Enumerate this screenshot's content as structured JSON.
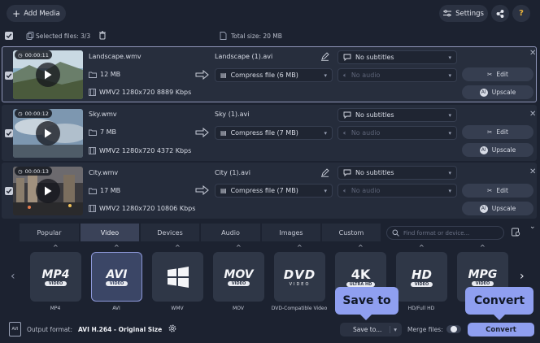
{
  "toolbar": {
    "add_media_label": "Add Media",
    "settings_label": "Settings",
    "help_label": "?"
  },
  "summary": {
    "selected_label": "Selected files: 3/3",
    "total_label": "Total size: 20 MB"
  },
  "files": [
    {
      "duration": "00:00:11",
      "name": "Landscape.wmv",
      "size": "12 MB",
      "codec": "WMV2 1280x720 8889 Kbps",
      "output_name": "Landscape (1).avi",
      "compress": "Compress file (6 MB)",
      "subtitles": "No subtitles",
      "audio": "No audio",
      "edit_label": "Edit",
      "upscale_label": "Upscale"
    },
    {
      "duration": "00:00:12",
      "name": "Sky.wmv",
      "size": "7 MB",
      "codec": "WMV2 1280x720 4372 Kbps",
      "output_name": "Sky (1).avi",
      "compress": "Compress file (7 MB)",
      "subtitles": "No subtitles",
      "audio": "No audio",
      "edit_label": "Edit",
      "upscale_label": "Upscale"
    },
    {
      "duration": "00:00:13",
      "name": "City.wmv",
      "size": "17 MB",
      "codec": "WMV2 1280x720 10806 Kbps",
      "output_name": "City (1).avi",
      "compress": "Compress file (7 MB)",
      "subtitles": "No subtitles",
      "audio": "No audio",
      "edit_label": "Edit",
      "upscale_label": "Upscale"
    }
  ],
  "format_tabs": [
    "Popular",
    "Video",
    "Devices",
    "Audio",
    "Images",
    "Custom"
  ],
  "active_tab": "Video",
  "format_search_placeholder": "Find format or device...",
  "formats": [
    {
      "logo": "MP4",
      "sub": "VIDEO",
      "label": "MP4"
    },
    {
      "logo": "AVI",
      "sub": "VIDEO",
      "label": "AVI"
    },
    {
      "logo": "",
      "sub": "",
      "label": "WMV"
    },
    {
      "logo": "MOV",
      "sub": "VIDEO",
      "label": "MOV"
    },
    {
      "logo": "DVD",
      "sub": "VIDEO",
      "label": "DVD-Compatible Video"
    },
    {
      "logo": "4K",
      "sub": "ULTRA HD",
      "label": "4K Ultra HD"
    },
    {
      "logo": "HD",
      "sub": "VIDEO",
      "label": "HD/Full HD"
    },
    {
      "logo": "MPG",
      "sub": "VIDEO",
      "label": "MPG"
    }
  ],
  "bottom": {
    "output_format_label": "Output format:",
    "output_format_value": "AVI H.264 - Original Size",
    "save_to_label": "Save to...",
    "merge_files_label": "Merge files:",
    "convert_label": "Convert"
  },
  "tooltips": {
    "save_to": "Save to",
    "convert": "Convert"
  },
  "colors": {
    "accent": "#8f9ff0",
    "background": "#1c2230",
    "help_icon": "#e9b23a"
  }
}
